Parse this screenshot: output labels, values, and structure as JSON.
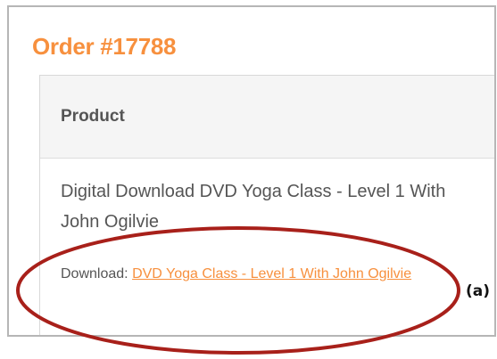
{
  "order": {
    "title": "Order #17788"
  },
  "table": {
    "header_product": "Product"
  },
  "item": {
    "name": "Digital Download DVD Yoga Class - Level 1 With John Ogilvie",
    "download_label": "Download:",
    "download_link_text": "DVD Yoga Class - Level 1 With John Ogilvie"
  },
  "annotation": {
    "label": "(a)"
  },
  "colors": {
    "accent": "#f7903e",
    "text": "#555555",
    "annotation_stroke": "#a8201a"
  }
}
